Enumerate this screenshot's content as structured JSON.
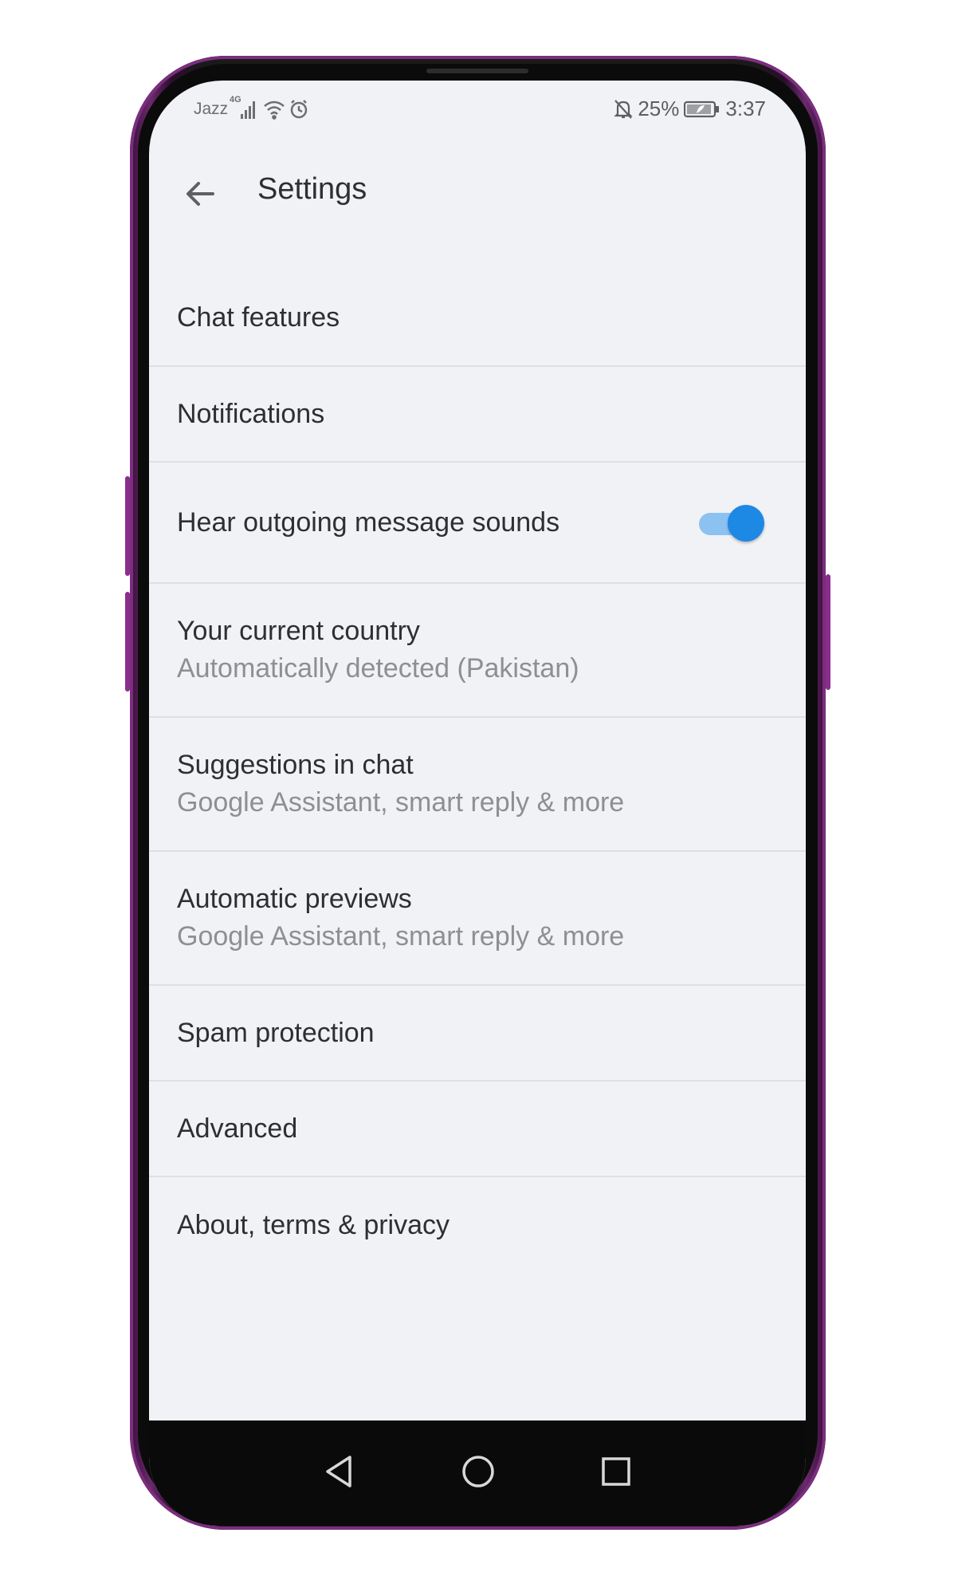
{
  "status_bar": {
    "carrier": "Jazz",
    "network": "4G",
    "battery_percent": "25%",
    "time": "3:37",
    "icons": [
      "signal-icon",
      "wifi-icon",
      "alarm-icon",
      "mute-icon",
      "battery-icon"
    ]
  },
  "app_bar": {
    "title": "Settings",
    "back_icon": "arrow-back-icon"
  },
  "settings": {
    "items": [
      {
        "label": "Chat features"
      },
      {
        "label": "Notifications"
      },
      {
        "label": "Hear outgoing message sounds",
        "toggle_on": true
      },
      {
        "label": "Your current country",
        "subtitle": "Automatically detected (Pakistan)"
      },
      {
        "label": "Suggestions in chat",
        "subtitle": "Google Assistant, smart reply & more"
      },
      {
        "label": "Automatic previews",
        "subtitle": "Google Assistant, smart reply & more"
      },
      {
        "label": "Spam protection"
      },
      {
        "label": "Advanced"
      },
      {
        "label": "About, terms & privacy"
      }
    ]
  },
  "nav_bar": {
    "buttons": [
      "back-triangle-icon",
      "home-circle-icon",
      "recents-square-icon"
    ]
  },
  "colors": {
    "accent": "#1e88e5",
    "background": "#f1f2f6",
    "phone_frame": "#7b2d7e"
  }
}
